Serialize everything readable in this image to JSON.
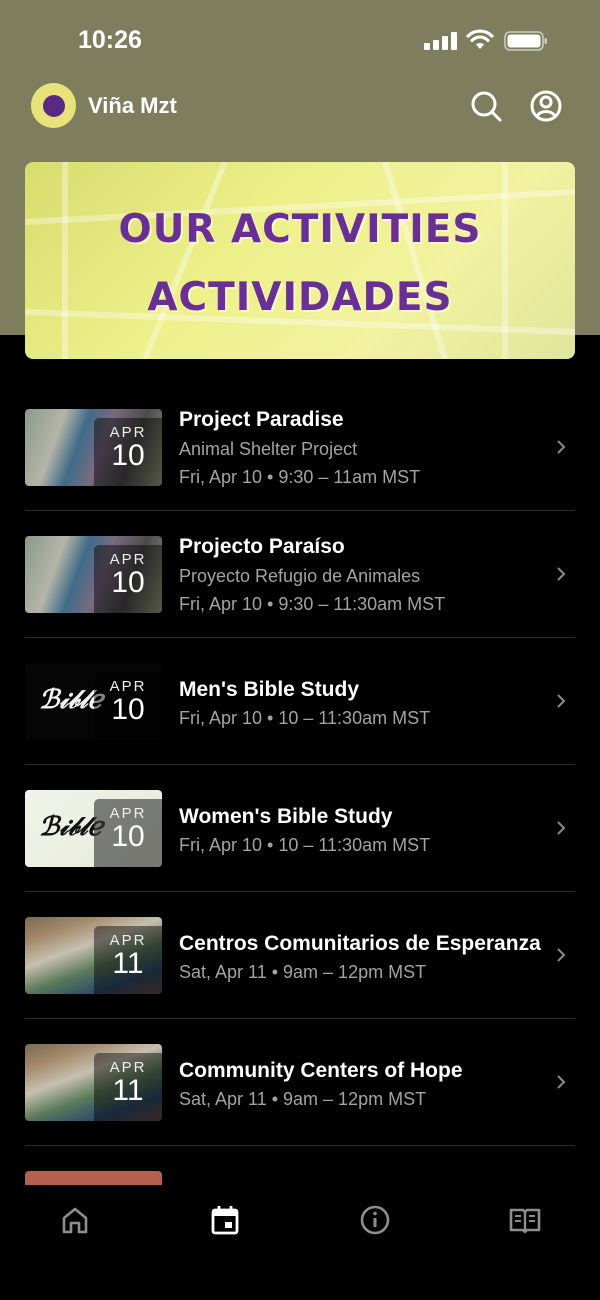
{
  "status_bar": {
    "time": "10:26"
  },
  "header": {
    "app_title": "Viña Mzt"
  },
  "banner": {
    "line1": "OUR ACTIVITIES",
    "line2": "ACTIVIDADES"
  },
  "events": [
    {
      "title": "Project Paradise",
      "subtitle": "Animal Shelter Project",
      "time": "Fri, Apr 10 • 9:30 – 11am MST",
      "month": "APR",
      "day": "10",
      "thumb": "photo-shelter-icon"
    },
    {
      "title": "Projecto Paraíso",
      "subtitle": "Proyecto Refugio de Animales",
      "time": "Fri, Apr 10 • 9:30 – 11:30am MST",
      "month": "APR",
      "day": "10",
      "thumb": "photo-shelter-icon"
    },
    {
      "title": "Men's Bible Study",
      "subtitle": "",
      "time": "Fri, Apr 10 • 10 – 11:30am MST",
      "month": "APR",
      "day": "10",
      "thumb": "bible-study-dark-icon"
    },
    {
      "title": "Women's Bible Study",
      "subtitle": "",
      "time": "Fri, Apr 10 • 10 – 11:30am MST",
      "month": "APR",
      "day": "10",
      "thumb": "bible-study-light-icon"
    },
    {
      "title": "Centros Comunitarios de Esperanza",
      "subtitle": "",
      "time": "Sat, Apr 11 • 9am – 12pm MST",
      "month": "APR",
      "day": "11",
      "thumb": "photo-children-icon"
    },
    {
      "title": "Community Centers of Hope",
      "subtitle": "",
      "time": "Sat, Apr 11 • 9am – 12pm MST",
      "month": "APR",
      "day": "11",
      "thumb": "photo-children-icon"
    }
  ],
  "colors": {
    "header_bg": "#7e7e5f",
    "banner_text": "#6a2f96",
    "banner_bg": "#eef08a",
    "list_bg": "#000000",
    "secondary_text": "#a3a3a3"
  },
  "tab_bar": {
    "items": [
      "home-icon",
      "calendar-icon",
      "info-icon",
      "book-icon"
    ],
    "active": "calendar-icon"
  }
}
